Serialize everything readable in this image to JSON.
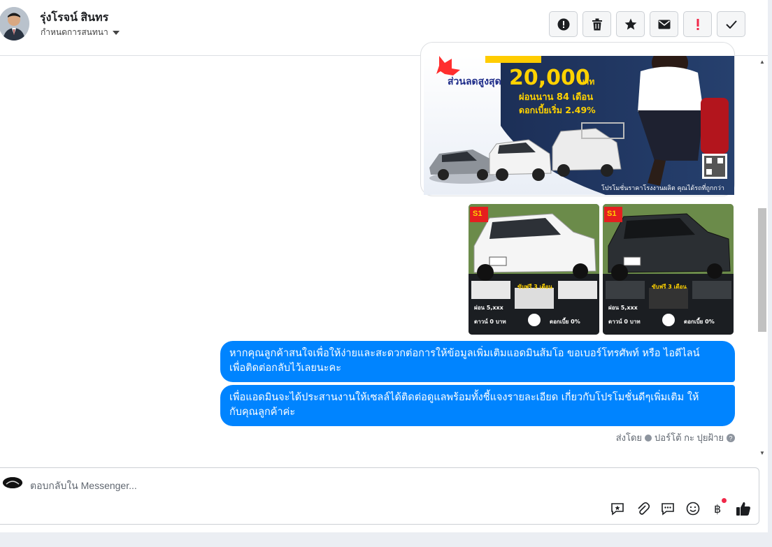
{
  "header": {
    "contact_name": "รุ่งโรจน์ สินทร",
    "assign_label": "กำหนดการสนทนา",
    "actions": [
      {
        "name": "report-button",
        "icon": "alert-circle-icon"
      },
      {
        "name": "delete-button",
        "icon": "trash-icon"
      },
      {
        "name": "star-button",
        "icon": "star-icon"
      },
      {
        "name": "mark-unread-button",
        "icon": "envelope-icon"
      },
      {
        "name": "important-button",
        "icon": "exclamation-icon"
      },
      {
        "name": "done-button",
        "icon": "checkmark-icon"
      }
    ]
  },
  "ad_image": {
    "discount_text": "ส่วนลดสูงสุด",
    "discount_amount": "20,000",
    "currency": "บาท",
    "installment": "ผ่อนนาน 84 เดือน",
    "interest": "ดอกเบี้ยเริ่ม 2.49%",
    "footer": "โปรโมชั่นราคาโรงงานผลิต คุณได้รถที่ถูกกว่า"
  },
  "truck_cards": [
    {
      "tag": "S1",
      "free": "ขับฟรี 3 เดือน",
      "monthly": "ผ่อน 5,xxx",
      "down": "ดาวน์ 0 บาท",
      "interest": "ดอกเบี้ย 0%",
      "color": "#f4f4f4"
    },
    {
      "tag": "S1",
      "free": "ขับฟรี 3 เดือน",
      "monthly": "ผ่อน 5,xxx",
      "down": "ดาวน์ 0 บาท",
      "interest": "ดอกเบี้ย 0%",
      "color": "#2b2f33"
    }
  ],
  "messages": [
    {
      "text_line1": "หากคุณลูกค้าสนใจเพื่อให้ง่ายและสะดวกต่อการให้ข้อมูลเพิ่มเติมแอดมินส้มโอ ขอเบอร์โทรศัพท์ หรือ ไอดีไลน์",
      "text_line2": "เพื่อติดต่อกลับไว้เลยนะคะ"
    },
    {
      "text_line1": "เพื่อแอดมินจะได้ประสานงานให้เซลล์ได้ติดต่อดูแลพร้อมทั้งชี้แจงรายละเอียด เกี่ยวกับโปรโมชั่นดีๆเพิ่มเติม ให้",
      "text_line2": "กับคุณลูกค้าค่ะ"
    }
  ],
  "sent_by": {
    "prefix": "ส่งโดย",
    "sender": "ปอร์โต้ กะ ปุยฝ้าย",
    "help_icon": "question-circle-icon"
  },
  "composer": {
    "placeholder": "ตอบกลับใน Messenger...",
    "tools": [
      "saved-reply-icon",
      "attachment-icon",
      "chat-bubble-icon",
      "emoji-icon",
      "baht-payment-icon",
      "thumbs-up-icon"
    ]
  },
  "colors": {
    "accent": "#0084ff",
    "badge": "#f02849",
    "thumb": "#0a7cff"
  }
}
